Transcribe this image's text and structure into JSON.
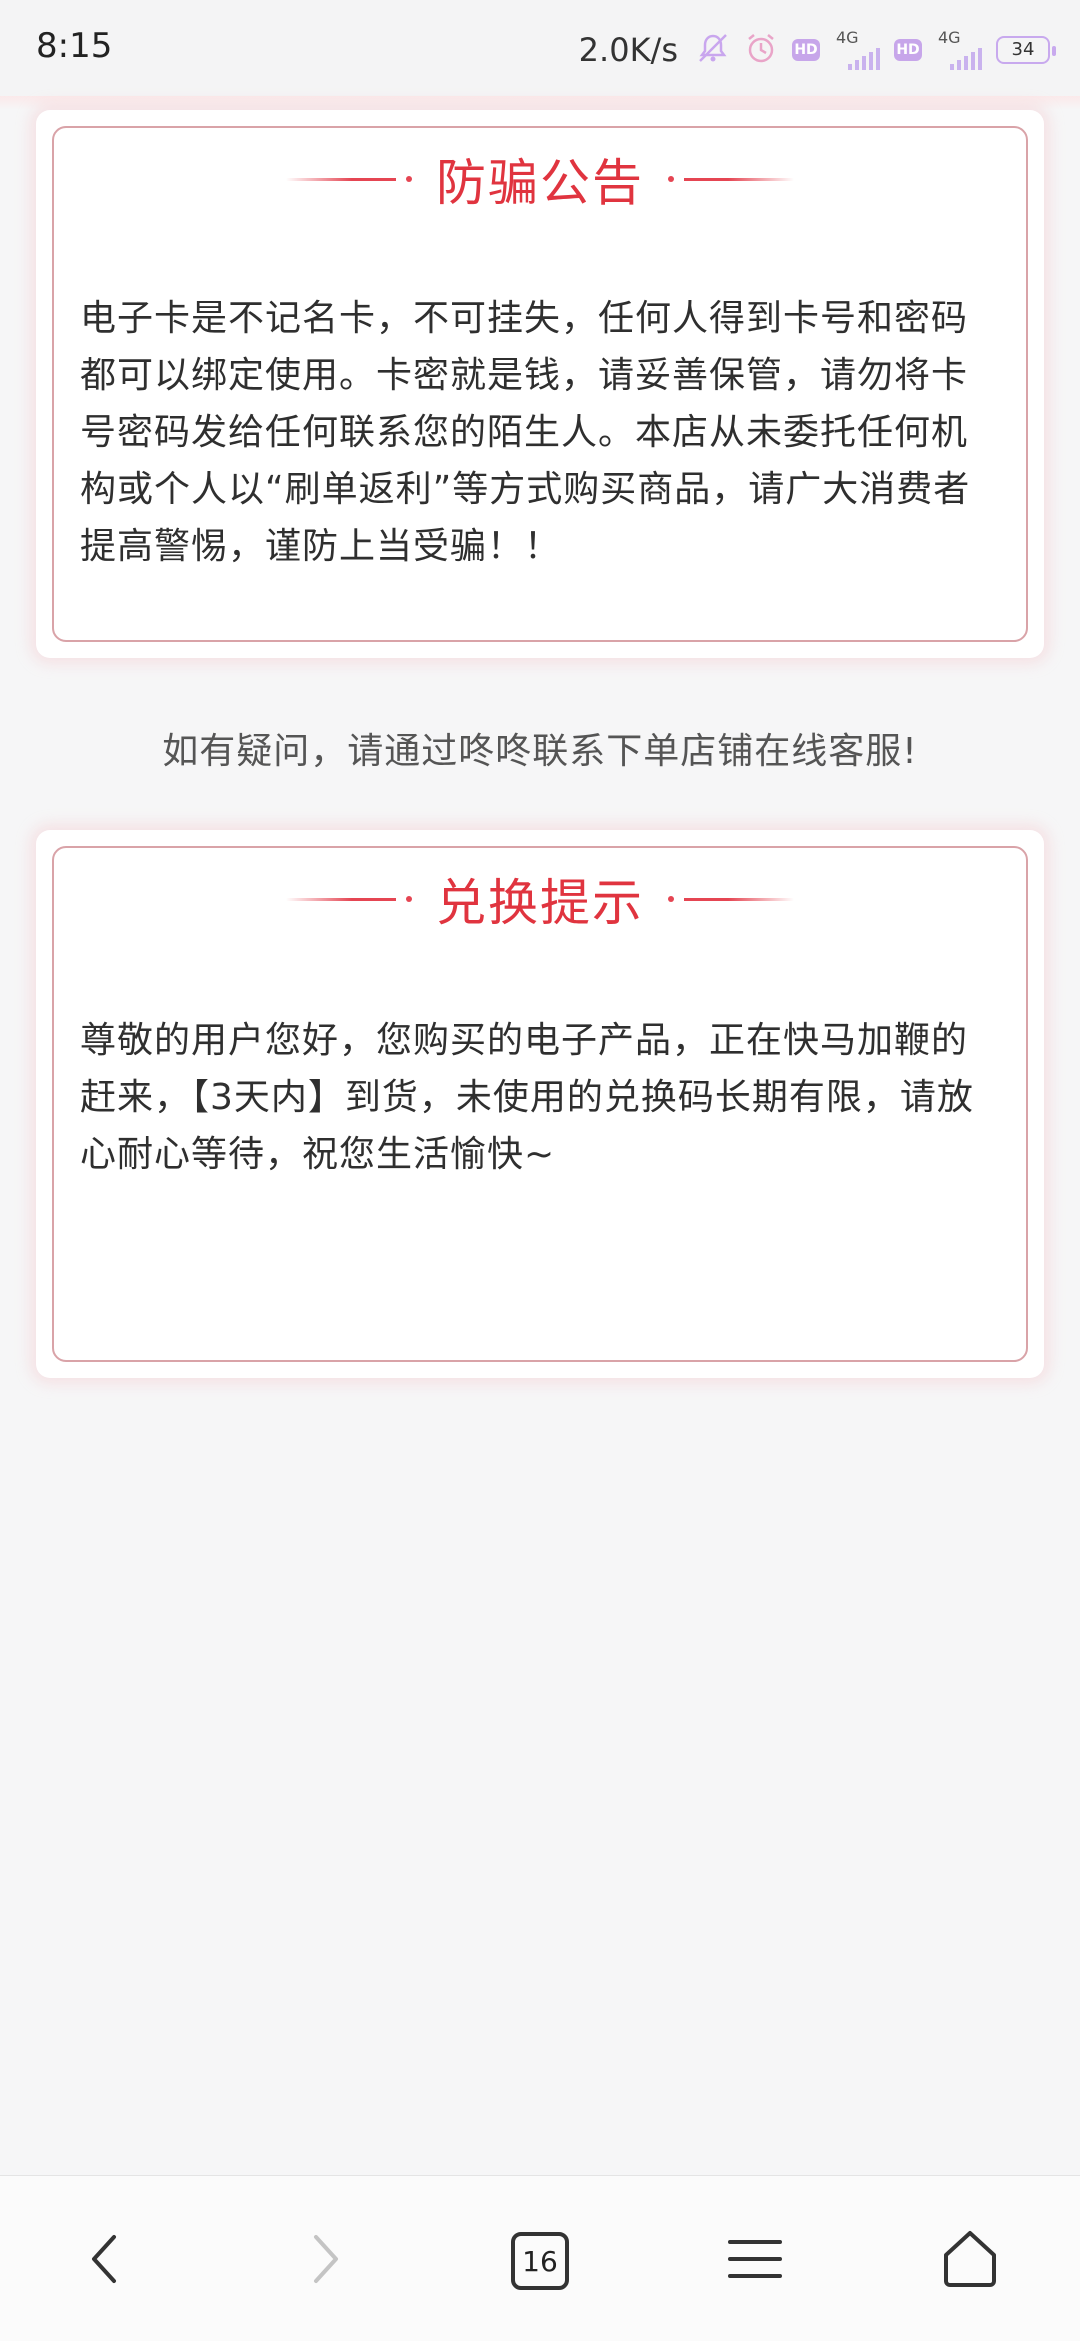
{
  "status_bar": {
    "time": "8:15",
    "net_speed": "2.0K/s",
    "sim1_tech": "4G",
    "sim2_tech": "4G",
    "hd_label": "HD",
    "battery_level": "34",
    "icons": [
      "bell-muted-icon",
      "alarm-icon",
      "hd-icon",
      "signal-icon",
      "hd-icon",
      "signal-icon",
      "battery-icon"
    ]
  },
  "anti_fraud": {
    "title": "防骗公告",
    "body": "电子卡是不记名卡，不可挂失，任何人得到卡号和密码都可以绑定使用。卡密就是钱，请妥善保管，请勿将卡号密码发给任何联系您的陌生人。本店从未委托任何机构或个人以“刷单返利”等方式购买商品，请广大消费者提高警惕，谨防上当受骗！！"
  },
  "help_notice": "如有疑问，请通过咚咚联系下单店铺在线客服!",
  "exchange_tip": {
    "title": "兑换提示",
    "body": "尊敬的用户您好，您购买的电子产品，正在快马加鞭的赶来，【3天内】到货，未使用的兑换码长期有限，请放心耐心等待，祝您生活愉快~"
  },
  "bottom_nav": {
    "tab_count": "16",
    "items": [
      "back-icon",
      "forward-icon",
      "tabs-icon",
      "menu-icon",
      "home-icon"
    ]
  },
  "colors": {
    "accent": "#e0343f",
    "card_border": "#d9a3a8",
    "background": "#f6f6f7"
  }
}
